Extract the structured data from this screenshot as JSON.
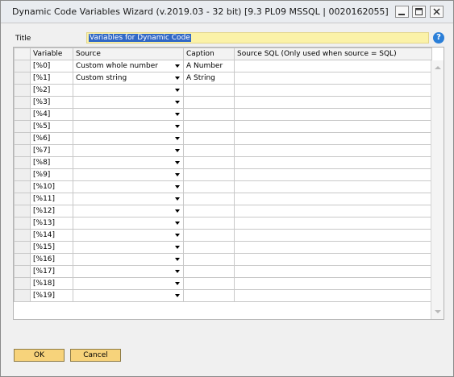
{
  "window": {
    "title": "Dynamic Code Variables Wizard (v.2019.03 - 32 bit) [9.3 PL09 MSSQL | 0020162055]"
  },
  "form": {
    "title_label": "Title",
    "title_value": "Variables for Dynamic Code",
    "help_glyph": "?"
  },
  "grid": {
    "columns": [
      "Variable",
      "Source",
      "Caption",
      "Source SQL (Only used when source = SQL)"
    ],
    "rows": [
      {
        "variable": "[%0]",
        "source": "Custom whole number",
        "caption": "A Number",
        "sql": ""
      },
      {
        "variable": "[%1]",
        "source": "Custom string",
        "caption": "A String",
        "sql": ""
      },
      {
        "variable": "[%2]",
        "source": "",
        "caption": "",
        "sql": ""
      },
      {
        "variable": "[%3]",
        "source": "",
        "caption": "",
        "sql": ""
      },
      {
        "variable": "[%4]",
        "source": "",
        "caption": "",
        "sql": ""
      },
      {
        "variable": "[%5]",
        "source": "",
        "caption": "",
        "sql": ""
      },
      {
        "variable": "[%6]",
        "source": "",
        "caption": "",
        "sql": ""
      },
      {
        "variable": "[%7]",
        "source": "",
        "caption": "",
        "sql": ""
      },
      {
        "variable": "[%8]",
        "source": "",
        "caption": "",
        "sql": ""
      },
      {
        "variable": "[%9]",
        "source": "",
        "caption": "",
        "sql": ""
      },
      {
        "variable": "[%10]",
        "source": "",
        "caption": "",
        "sql": ""
      },
      {
        "variable": "[%11]",
        "source": "",
        "caption": "",
        "sql": ""
      },
      {
        "variable": "[%12]",
        "source": "",
        "caption": "",
        "sql": ""
      },
      {
        "variable": "[%13]",
        "source": "",
        "caption": "",
        "sql": ""
      },
      {
        "variable": "[%14]",
        "source": "",
        "caption": "",
        "sql": ""
      },
      {
        "variable": "[%15]",
        "source": "",
        "caption": "",
        "sql": ""
      },
      {
        "variable": "[%16]",
        "source": "",
        "caption": "",
        "sql": ""
      },
      {
        "variable": "[%17]",
        "source": "",
        "caption": "",
        "sql": ""
      },
      {
        "variable": "[%18]",
        "source": "",
        "caption": "",
        "sql": ""
      },
      {
        "variable": "[%19]",
        "source": "",
        "caption": "",
        "sql": ""
      }
    ]
  },
  "buttons": {
    "ok": "OK",
    "cancel": "Cancel"
  },
  "colors": {
    "title_field_bg": "#fbf2a8",
    "selection": "#3168c6",
    "button_bg": "#f7d37b"
  }
}
